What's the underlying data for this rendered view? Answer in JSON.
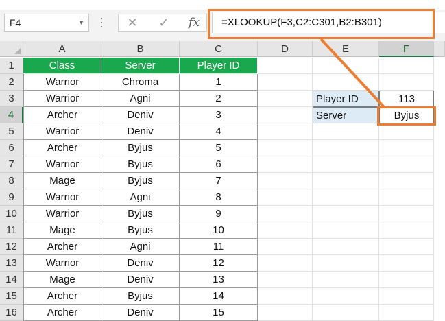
{
  "formula_bar": {
    "name_box": "F4",
    "cancel_glyph": "✕",
    "enter_glyph": "✓",
    "fx_label": "fx",
    "formula": "=XLOOKUP(F3,C2:C301,B2:B301)"
  },
  "columns": [
    "A",
    "B",
    "C",
    "D",
    "E",
    "F"
  ],
  "rows": [
    "1",
    "2",
    "3",
    "4",
    "5",
    "6",
    "7",
    "8",
    "9",
    "10",
    "11",
    "12",
    "13",
    "14",
    "15",
    "16"
  ],
  "table": {
    "headers": [
      "Class",
      "Server",
      "Player ID"
    ],
    "rows": [
      [
        "Warrior",
        "Chroma",
        "1"
      ],
      [
        "Warrior",
        "Agni",
        "2"
      ],
      [
        "Archer",
        "Deniv",
        "3"
      ],
      [
        "Warrior",
        "Deniv",
        "4"
      ],
      [
        "Archer",
        "Byjus",
        "5"
      ],
      [
        "Warrior",
        "Byjus",
        "6"
      ],
      [
        "Mage",
        "Byjus",
        "7"
      ],
      [
        "Warrior",
        "Agni",
        "8"
      ],
      [
        "Warrior",
        "Byjus",
        "9"
      ],
      [
        "Mage",
        "Byjus",
        "10"
      ],
      [
        "Archer",
        "Agni",
        "11"
      ],
      [
        "Warrior",
        "Deniv",
        "12"
      ],
      [
        "Mage",
        "Deniv",
        "13"
      ],
      [
        "Archer",
        "Byjus",
        "14"
      ],
      [
        "Archer",
        "Deniv",
        "15"
      ]
    ]
  },
  "lookup": {
    "player_id_label": "Player ID",
    "player_id_value": "113",
    "server_label": "Server",
    "server_value": "Byjus"
  },
  "colors": {
    "header_fill": "#1aa84e",
    "label_fill": "#ddebf7",
    "highlight": "#ed7d31"
  }
}
